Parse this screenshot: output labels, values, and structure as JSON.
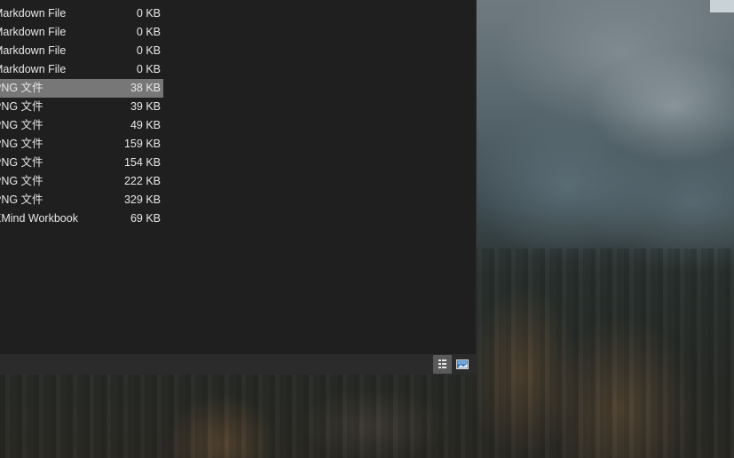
{
  "files": [
    {
      "type": "Markdown File",
      "size": "0 KB",
      "selected": false
    },
    {
      "type": "Markdown File",
      "size": "0 KB",
      "selected": false
    },
    {
      "type": "Markdown File",
      "size": "0 KB",
      "selected": false
    },
    {
      "type": "Markdown File",
      "size": "0 KB",
      "selected": false
    },
    {
      "type": "PNG 文件",
      "size": "38 KB",
      "selected": true
    },
    {
      "type": "PNG 文件",
      "size": "39 KB",
      "selected": false
    },
    {
      "type": "PNG 文件",
      "size": "49 KB",
      "selected": false
    },
    {
      "type": "PNG 文件",
      "size": "159 KB",
      "selected": false
    },
    {
      "type": "PNG 文件",
      "size": "154 KB",
      "selected": false
    },
    {
      "type": "PNG 文件",
      "size": "222 KB",
      "selected": false
    },
    {
      "type": "PNG 文件",
      "size": "329 KB",
      "selected": false
    },
    {
      "type": "XMind Workbook",
      "size": "69 KB",
      "selected": false
    }
  ],
  "status_bar": {
    "details_view_icon": "details-view-icon",
    "large_icons_view_icon": "large-icons-view-icon",
    "active_view": "details"
  },
  "colors": {
    "window_bg": "#1f1f1f",
    "selected_row_bg": "#777777",
    "text": "#e8e8e8"
  }
}
